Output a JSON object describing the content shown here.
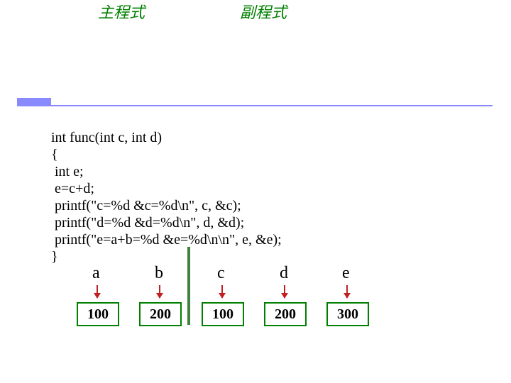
{
  "code": {
    "l1": "int func(int c, int d)",
    "l2": "{",
    "l3": " int e;",
    "l4": " e=c+d;",
    "l5": " printf(\"c=%d &c=%d\\n\", c, &c);",
    "l6": " printf(\"d=%d &d=%d\\n\", d, &d);",
    "l7": " printf(\"e=a+b=%d &e=%d\\n\\n\", e, &e);",
    "l8": "}"
  },
  "sections": {
    "main_label": "主程式",
    "sub_label": "副程式"
  },
  "columns": [
    {
      "var": "a",
      "val": "100"
    },
    {
      "var": "b",
      "val": "200"
    },
    {
      "var": "c",
      "val": "100"
    },
    {
      "var": "d",
      "val": "200"
    },
    {
      "var": "e",
      "val": "300"
    }
  ]
}
